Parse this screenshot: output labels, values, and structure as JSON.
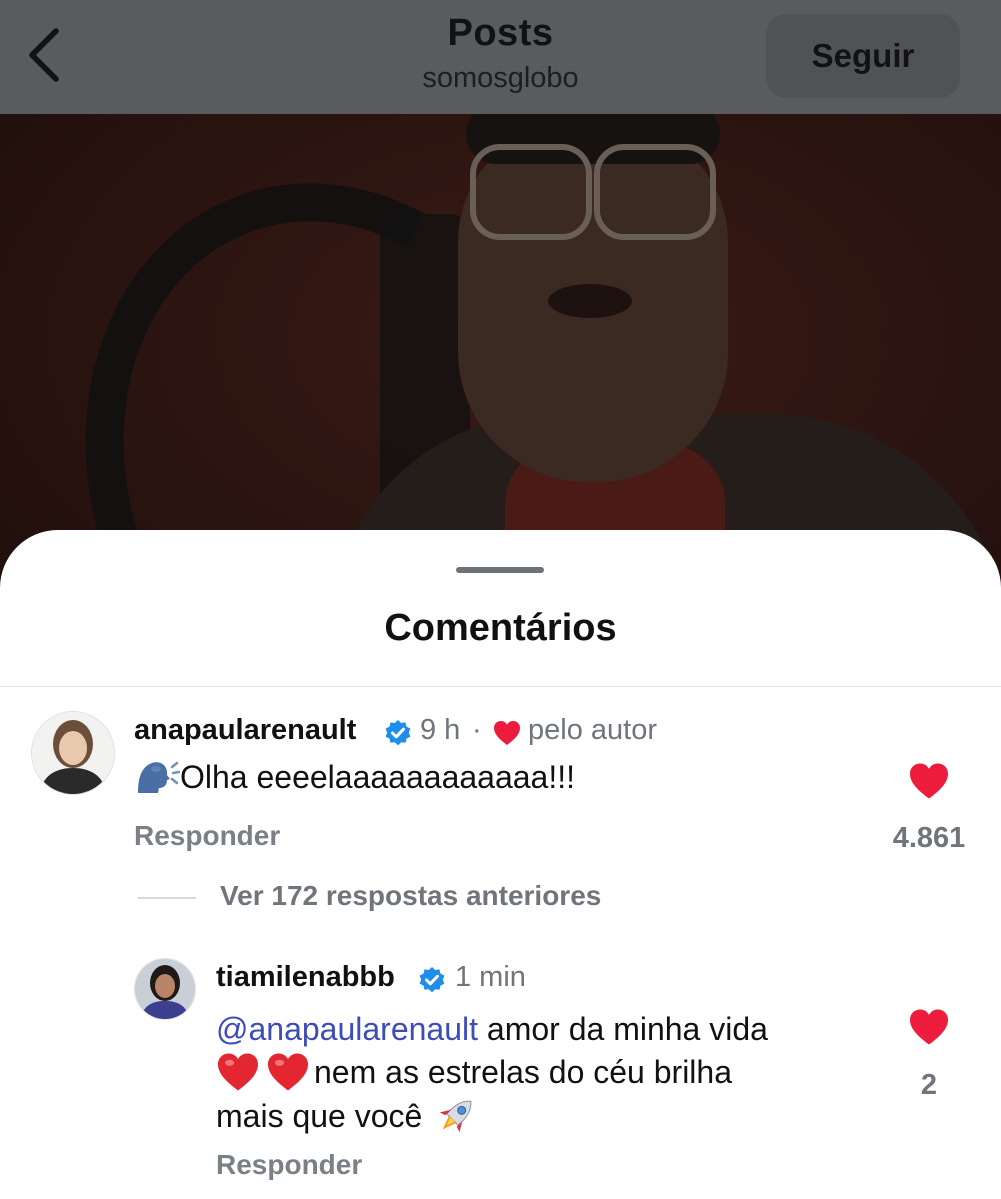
{
  "header": {
    "title": "Posts",
    "subtitle": "somosglobo",
    "follow_label": "Seguir"
  },
  "sheet": {
    "title": "Comentários"
  },
  "comments": [
    {
      "username": "anapaularenault",
      "verified": true,
      "time": "9 h",
      "separator": "·",
      "liked_by_author_label": "pelo autor",
      "text": "Olha eeeelaaaaaaaaaaaa!!!",
      "leading_emoji": "speaking-head-emoji",
      "reply_label": "Responder",
      "like_count": "4.861",
      "liked": true
    }
  ],
  "replies_toggle": {
    "label": "Ver 172 respostas anteriores"
  },
  "replies": [
    {
      "username": "tiamilenabbb",
      "verified": true,
      "time": "1 min",
      "mention": "@anapaularenault",
      "text_line1": "amor da minha vida",
      "text_line2": "nem as estrelas do céu brilha",
      "text_line3": "mais que você",
      "emojis": [
        "red-heart-emoji",
        "red-heart-emoji",
        "rocket-emoji"
      ],
      "reply_label": "Responder",
      "like_count": "2",
      "liked": true
    }
  ],
  "colors": {
    "header_bg": "#585c5e",
    "like_red": "#ed1c3c",
    "verified_blue": "#1f8ded",
    "mention_blue": "#3d4db7",
    "meta_gray": "#6f757b"
  }
}
